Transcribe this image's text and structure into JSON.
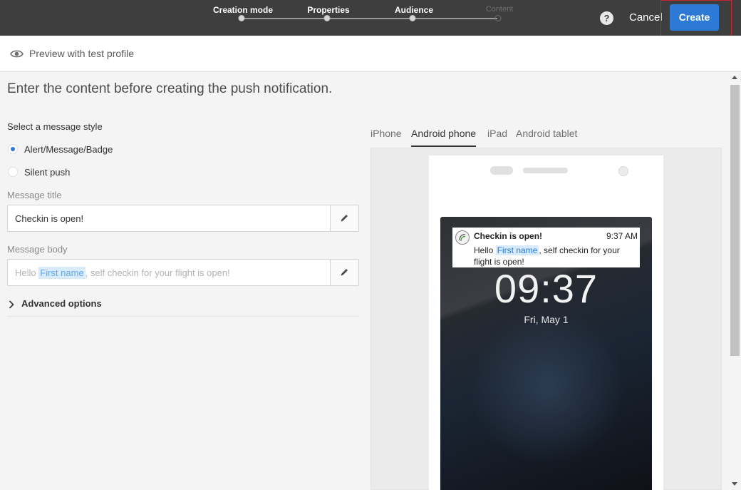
{
  "wizard": {
    "steps": [
      {
        "label": "Creation mode",
        "state": "done"
      },
      {
        "label": "Properties",
        "state": "done"
      },
      {
        "label": "Audience",
        "state": "current"
      },
      {
        "label": "Content",
        "state": "pending"
      }
    ],
    "help_label": "?",
    "cancel_label": "Cancel",
    "create_label": "Create",
    "highlight_color": "#c2272d"
  },
  "preview_bar": {
    "icon": "eye-icon",
    "label": "Preview with test profile"
  },
  "main": {
    "headline": "Enter the content before creating the push notification.",
    "style_label": "Select a message style",
    "styles": [
      {
        "label": "Alert/Message/Badge",
        "selected": true
      },
      {
        "label": "Silent push",
        "selected": false
      }
    ],
    "title_label": "Message title",
    "title_value": "Checkin is open!",
    "body_label": "Message body",
    "body_prefix": "Hello ",
    "body_tag": "First name",
    "body_suffix": ", self checkin for your flight is open!",
    "advanced_label": "Advanced options"
  },
  "device_tabs": {
    "items": [
      "iPhone",
      "Android phone",
      "iPad",
      "Android tablet"
    ],
    "active": "Android phone"
  },
  "phone_preview": {
    "notification_title": "Checkin is open!",
    "notification_time": "9:37 AM",
    "body_prefix": "Hello ",
    "body_tag": "First name",
    "body_suffix": ", self checkin for your flight is open!",
    "clock": "09:37",
    "date": "Fri, May 1"
  },
  "colors": {
    "accent": "#2c7ad6",
    "topbar": "#3e3e3e",
    "tag_bg": "#d7ebfb"
  }
}
